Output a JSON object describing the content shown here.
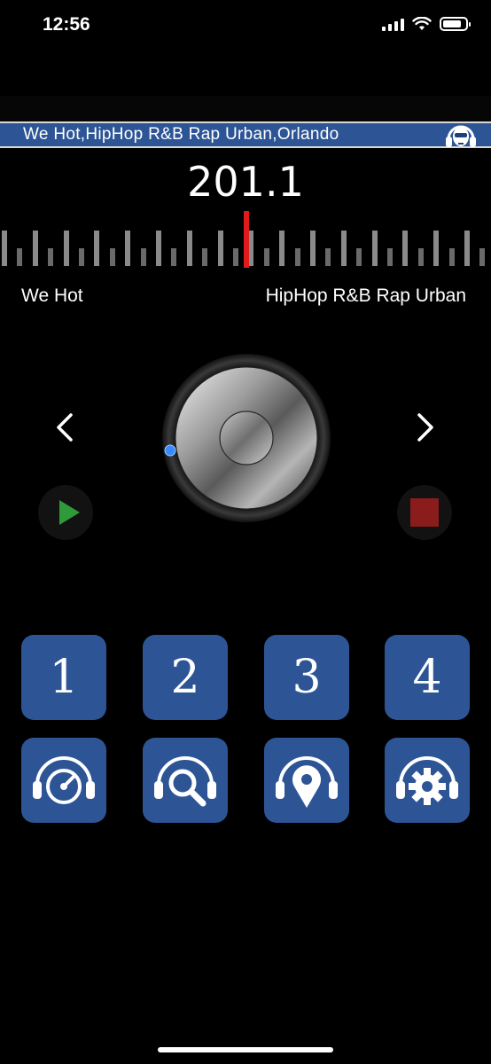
{
  "status_bar": {
    "time": "12:56",
    "battery_level": 0.85
  },
  "station": {
    "title": "We Hot,HipHop R&B Rap Urban,Orlando"
  },
  "tuner": {
    "frequency": "201.1"
  },
  "labels": {
    "left": "We Hot",
    "right": "HipHop R&B Rap Urban"
  },
  "controls": {
    "prev_icon": "chevron-left-icon",
    "next_icon": "chevron-right-icon",
    "play_icon": "play-icon",
    "stop_icon": "stop-icon"
  },
  "presets": [
    "1",
    "2",
    "3",
    "4"
  ],
  "actions": [
    {
      "name": "dashboard",
      "icon": "speedometer-headphones-icon"
    },
    {
      "name": "search",
      "icon": "search-headphones-icon"
    },
    {
      "name": "location",
      "icon": "location-headphones-icon"
    },
    {
      "name": "settings",
      "icon": "gear-headphones-icon"
    }
  ],
  "colors": {
    "accent": "#2d5596",
    "needle": "#e01b1b",
    "play": "#2f9a3a",
    "stop": "#8a1c1c",
    "knob_indicator": "#3a8bff"
  }
}
